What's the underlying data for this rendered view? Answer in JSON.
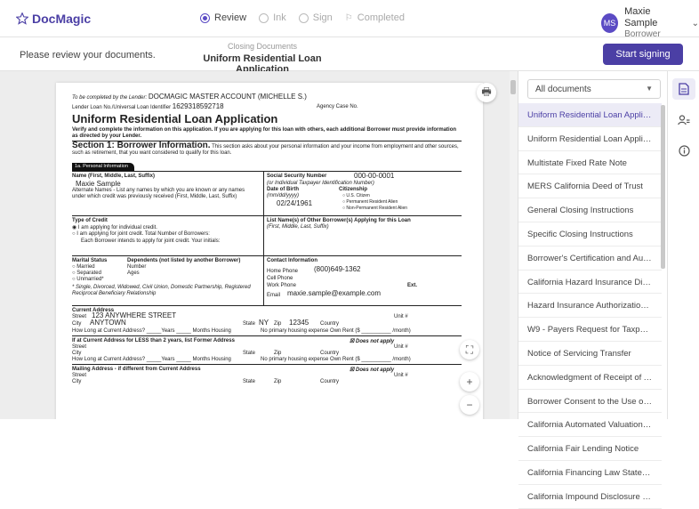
{
  "app": {
    "logo_text": "DocMagic"
  },
  "steps": [
    {
      "label": "Review",
      "active": true
    },
    {
      "label": "Ink",
      "active": false
    },
    {
      "label": "Sign",
      "active": false
    },
    {
      "label": "Completed",
      "active": false
    }
  ],
  "user": {
    "initials": "MS",
    "name": "Maxie Sample",
    "role": "Borrower"
  },
  "subbar": {
    "message": "Please review your documents.",
    "doc_category": "Closing Documents",
    "doc_title": "Uniform Residential Loan Application",
    "start_button": "Start signing"
  },
  "form": {
    "completed_by_label": "To be completed by the Lender:",
    "lender_name": "DOCMAGIC MASTER ACCOUNT (MICHELLE S.)",
    "loan_no_label": "Lender Loan No./Universal Loan Identifier",
    "loan_no": "1629318592718",
    "agency_case_label": "Agency Case No.",
    "title": "Uniform Residential Loan Application",
    "verify_text": "Verify and complete the information on this application. If you are applying for this loan with others, each additional Borrower must provide information as directed by your Lender.",
    "section1": "Section 1: Borrower Information.",
    "section1_desc": "This section asks about your personal information and your income from employment and other sources, such as retirement, that you want considered to qualify for this loan.",
    "tab_1a": "1a. Personal Information",
    "name_label": "Name (First, Middle, Last, Suffix)",
    "name_value": "Maxie Sample",
    "alt_names_label": "Alternate Names - List any names by which you are known or any names under which credit was previously received (First, Middle, Last, Suffix)",
    "ssn_label": "Social Security Number",
    "ssn_value": "000-00-0001",
    "itin_label": "(or Individual Taxpayer Identification Number)",
    "dob_label": "Date of Birth",
    "dob_format": "(mm/dd/yyyy)",
    "dob_value": "02/24/1961",
    "citizenship_label": "Citizenship",
    "citizen_options": [
      "U.S. Citizen",
      "Permanent Resident Alien",
      "Non-Permanent Resident Alien"
    ],
    "type_credit_label": "Type of Credit",
    "credit_individual": "I am applying for individual credit.",
    "credit_joint": "I am applying for joint credit. Total Number of Borrowers:",
    "credit_initials": "Each Borrower intends to apply for joint credit. Your initials:",
    "other_borrowers_label": "List Name(s) of Other Borrower(s) Applying for this Loan",
    "other_borrowers_sub": "(First, Middle, Last, Suffix)",
    "marital_label": "Marital Status",
    "marital_options": [
      "Married",
      "Separated",
      "Unmarried*"
    ],
    "dependents_label": "Dependents (not listed by another Borrower)",
    "dependents_number": "Number",
    "dependents_ages": "Ages",
    "unmarried_note": "* Single, Divorced, Widowed, Civil Union, Domestic Partnership, Registered Reciprocal Beneficiary Relationship",
    "contact_label": "Contact Information",
    "home_phone_label": "Home Phone",
    "home_phone": "(800)649-1362",
    "cell_phone_label": "Cell Phone",
    "work_phone_label": "Work Phone",
    "ext_label": "Ext.",
    "email_label": "Email",
    "email_value": "maxie.sample@example.com",
    "current_address_label": "Current Address",
    "street_label": "Street",
    "street_value": "123 ANYWHERE STREET",
    "unit_label": "Unit #",
    "city_label": "City",
    "city_value": "ANYTOWN",
    "state_label": "State",
    "state_value": "NY",
    "zip_label": "Zip",
    "zip_value": "12345",
    "country_label": "Country",
    "how_long_line": "How Long at Current Address? _____Years _____ Months Housing",
    "housing_options": "No primary housing expense   Own   Rent ($ __________ /month)",
    "former_label": "If at Current Address for LESS than 2 years, list Former Address",
    "does_not_apply": "Does not apply",
    "mailing_label": "Mailing Address - if different from Current Address"
  },
  "panel": {
    "filter": "All documents",
    "documents": [
      "Uniform Residential Loan Application",
      "Uniform Residential Loan Application - L...",
      "Multistate Fixed Rate Note",
      "MERS California Deed of Trust",
      "General Closing Instructions",
      "Specific Closing Instructions",
      "Borrower's Certification and Authorization",
      "California Hazard Insurance Disclosure",
      "Hazard Insurance Authorization and Re...",
      "W9 - Payers Request for Taxpayer ID",
      "Notice of Servicing Transfer",
      "Acknowledgment of Receipt of Appraisa...",
      "Borrower Consent to the Use of Tax Ret...",
      "California Automated Valuation Model ...",
      "California Fair Lending Notice",
      "California Financing Law Statement of L...",
      "California Impound Disclosure Waiver"
    ],
    "active_index": 0
  },
  "colors": {
    "brand": "#4b3fa5",
    "active_bg": "#ecebf6"
  }
}
